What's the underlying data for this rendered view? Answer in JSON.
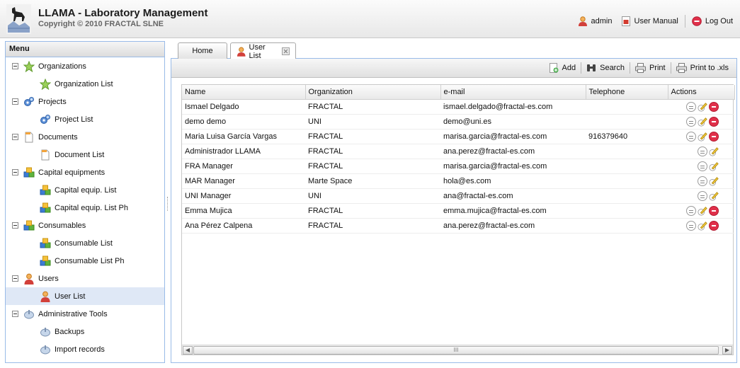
{
  "app": {
    "title": "LLAMA - Laboratory Management",
    "copyright": "Copyright © 2010 FRACTAL SLNE"
  },
  "header": {
    "user": "admin",
    "manual": "User Manual",
    "logout": "Log Out"
  },
  "menu": {
    "title": "Menu",
    "groups": [
      {
        "label": "Organizations",
        "icon": "star-icon",
        "items": [
          {
            "label": "Organization List",
            "icon": "star-icon"
          }
        ]
      },
      {
        "label": "Projects",
        "icon": "gears-icon",
        "items": [
          {
            "label": "Project List",
            "icon": "gears-icon"
          }
        ]
      },
      {
        "label": "Documents",
        "icon": "document-icon",
        "items": [
          {
            "label": "Document List",
            "icon": "document-icon"
          }
        ]
      },
      {
        "label": "Capital equipments",
        "icon": "cubes-icon",
        "items": [
          {
            "label": "Capital equip. List",
            "icon": "cubes-icon"
          },
          {
            "label": "Capital equip. List Ph",
            "icon": "cubes-icon"
          }
        ]
      },
      {
        "label": "Consumables",
        "icon": "cubes-icon",
        "items": [
          {
            "label": "Consumable List",
            "icon": "cubes-icon"
          },
          {
            "label": "Consumable List Ph",
            "icon": "cubes-icon"
          }
        ]
      },
      {
        "label": "Users",
        "icon": "user-icon",
        "items": [
          {
            "label": "User List",
            "icon": "user-icon",
            "selected": true
          }
        ]
      },
      {
        "label": "Administrative Tools",
        "icon": "satellite-icon",
        "items": [
          {
            "label": "Backups",
            "icon": "satellite-icon"
          },
          {
            "label": "Import records",
            "icon": "satellite-icon"
          }
        ]
      }
    ]
  },
  "tabs": {
    "home": "Home",
    "active": "User List"
  },
  "toolbar": {
    "add": "Add",
    "search": "Search",
    "print": "Print",
    "print_xls": "Print to .xls"
  },
  "grid": {
    "columns": [
      "Name",
      "Organization",
      "e-mail",
      "Telephone",
      "Actions"
    ],
    "rows": [
      {
        "name": "Ismael Delgado",
        "org": "FRACTAL",
        "email": "ismael.delgado@fractal-es.com",
        "phone": "",
        "delete": true
      },
      {
        "name": "demo demo",
        "org": "UNI",
        "email": "demo@uni.es",
        "phone": "",
        "delete": true
      },
      {
        "name": "Maria Luisa García Vargas",
        "org": "FRACTAL",
        "email": "marisa.garcia@fractal-es.com",
        "phone": "916379640",
        "delete": true
      },
      {
        "name": "Administrador LLAMA",
        "org": "FRACTAL",
        "email": "ana.perez@fractal-es.com",
        "phone": "",
        "delete": false
      },
      {
        "name": "FRA Manager",
        "org": "FRACTAL",
        "email": "marisa.garcia@fractal-es.com",
        "phone": "",
        "delete": false
      },
      {
        "name": "MAR Manager",
        "org": "Marte Space",
        "email": "hola@es.com",
        "phone": "",
        "delete": false
      },
      {
        "name": "UNI Manager",
        "org": "UNI",
        "email": "ana@fractal-es.com",
        "phone": "",
        "delete": false
      },
      {
        "name": "Emma Mujica",
        "org": "FRACTAL",
        "email": "emma.mujica@fractal-es.com",
        "phone": "",
        "delete": true
      },
      {
        "name": "Ana Pérez Calpena",
        "org": "FRACTAL",
        "email": "ana.perez@fractal-es.com",
        "phone": "",
        "delete": true
      }
    ],
    "scroll_grip": "III"
  }
}
